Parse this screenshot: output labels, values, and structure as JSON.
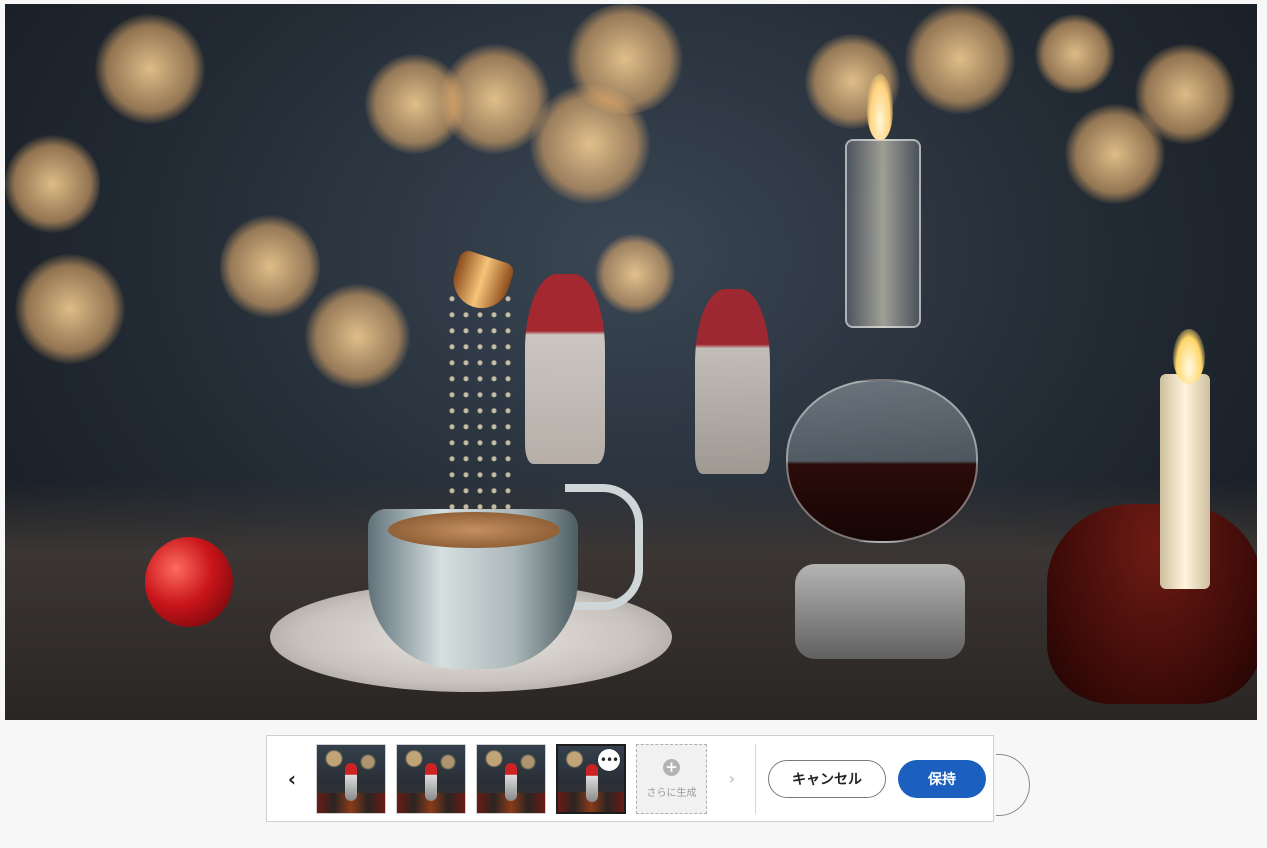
{
  "canvas": {
    "description_icon": "generated-image"
  },
  "toolbar": {
    "prev_icon": "‹",
    "next_icon": "›",
    "more_icon": "•••",
    "generate_more_icon": "+",
    "generate_more_label": "さらに生成",
    "cancel_label": "キャンセル",
    "keep_label": "保持",
    "thumbnails": [
      {
        "selected": false
      },
      {
        "selected": false
      },
      {
        "selected": false
      },
      {
        "selected": true
      }
    ]
  },
  "colors": {
    "primary": "#1b5fbf",
    "toolbar_bg": "#ffffff",
    "page_bg": "#f7f7f7"
  }
}
